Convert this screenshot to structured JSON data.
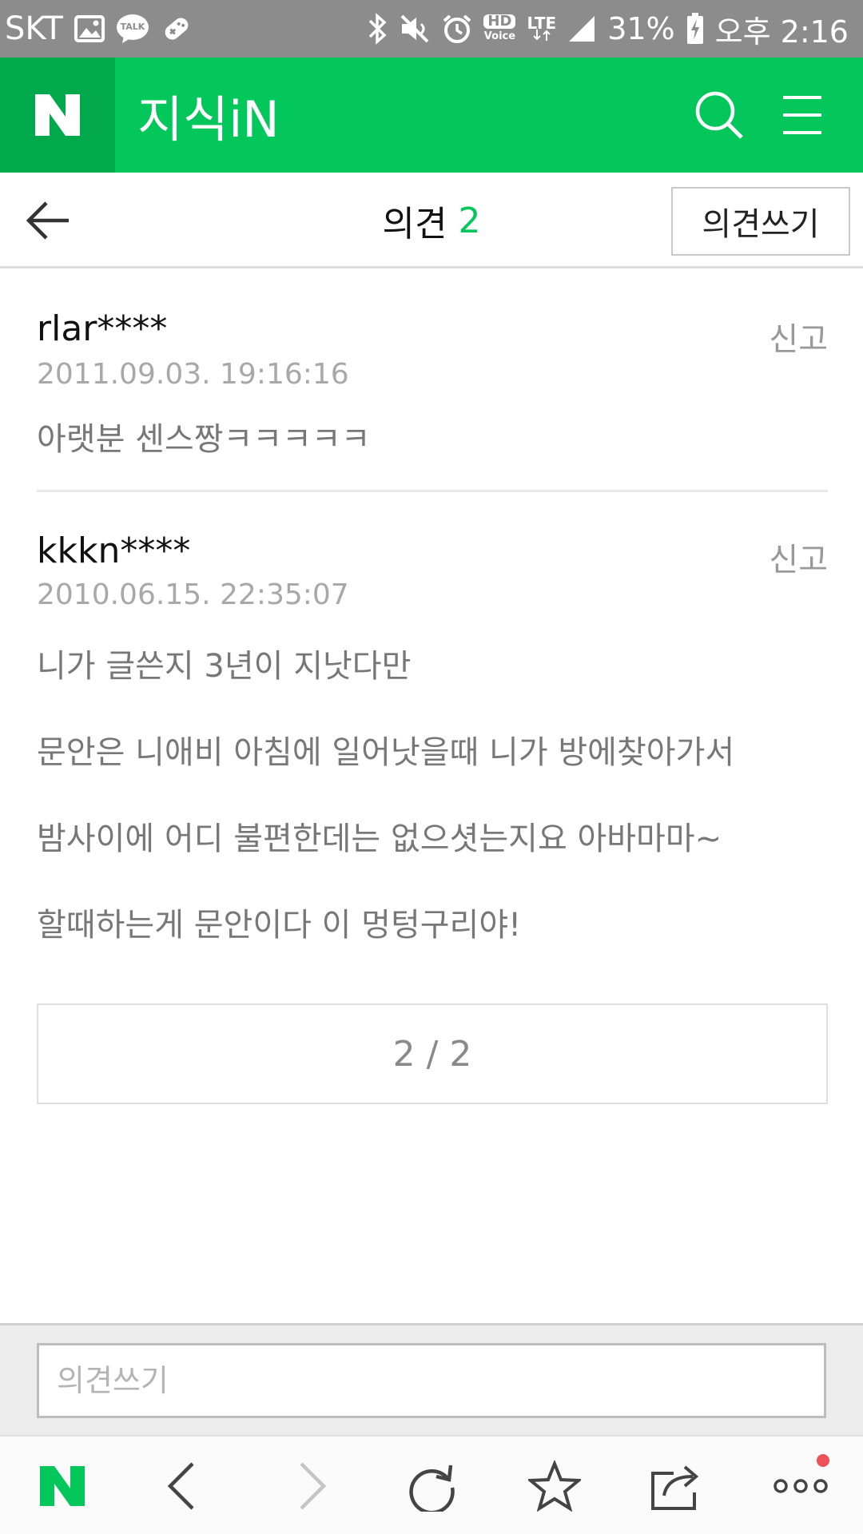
{
  "status_bar": {
    "carrier": "SKT",
    "talk_label": "TALK",
    "hd_label": "HD",
    "voice_label": "Voice",
    "lte_label": "LTE",
    "battery": "31%",
    "time": "오후 2:16",
    "icons": [
      "image-icon",
      "talk-icon",
      "game-icon",
      "bluetooth-icon",
      "mute-icon",
      "alarm-icon",
      "hd-voice-icon",
      "lte-icon",
      "signal-icon",
      "battery-charging-icon"
    ]
  },
  "header": {
    "logo": "N",
    "title": "지식iN",
    "icons": [
      "search-icon",
      "menu-icon"
    ],
    "color": "#03c75a",
    "logo_bg": "#02a94c"
  },
  "subheader": {
    "title": "의견",
    "count": "2",
    "write_button": "의견쓰기"
  },
  "comments": [
    {
      "author": "rlar****",
      "date": "2011.09.03. 19:16:16",
      "report": "신고",
      "lines": [
        "아랫분 센스짱ㅋㅋㅋㅋㅋ"
      ]
    },
    {
      "author": "kkkn****",
      "date": "2010.06.15. 22:35:07",
      "report": "신고",
      "lines": [
        "니가 글쓴지 3년이 지낫다만",
        "문안은 니애비 아침에 일어낫을때 니가 방에찾아가서",
        "밤사이에 어디 불편한데는 없으셧는지요 아바마마~",
        "할때하는게 문안이다 이 멍텅구리야!"
      ]
    }
  ],
  "pagination": {
    "text": "2 / 2"
  },
  "input": {
    "placeholder": "의견쓰기",
    "value": ""
  },
  "toolbar": {
    "logo": "N",
    "items": [
      "naver-home-icon",
      "back-icon",
      "forward-icon",
      "refresh-icon",
      "bookmark-star-icon",
      "share-icon",
      "more-icon"
    ],
    "badge_color": "#f0505a"
  }
}
